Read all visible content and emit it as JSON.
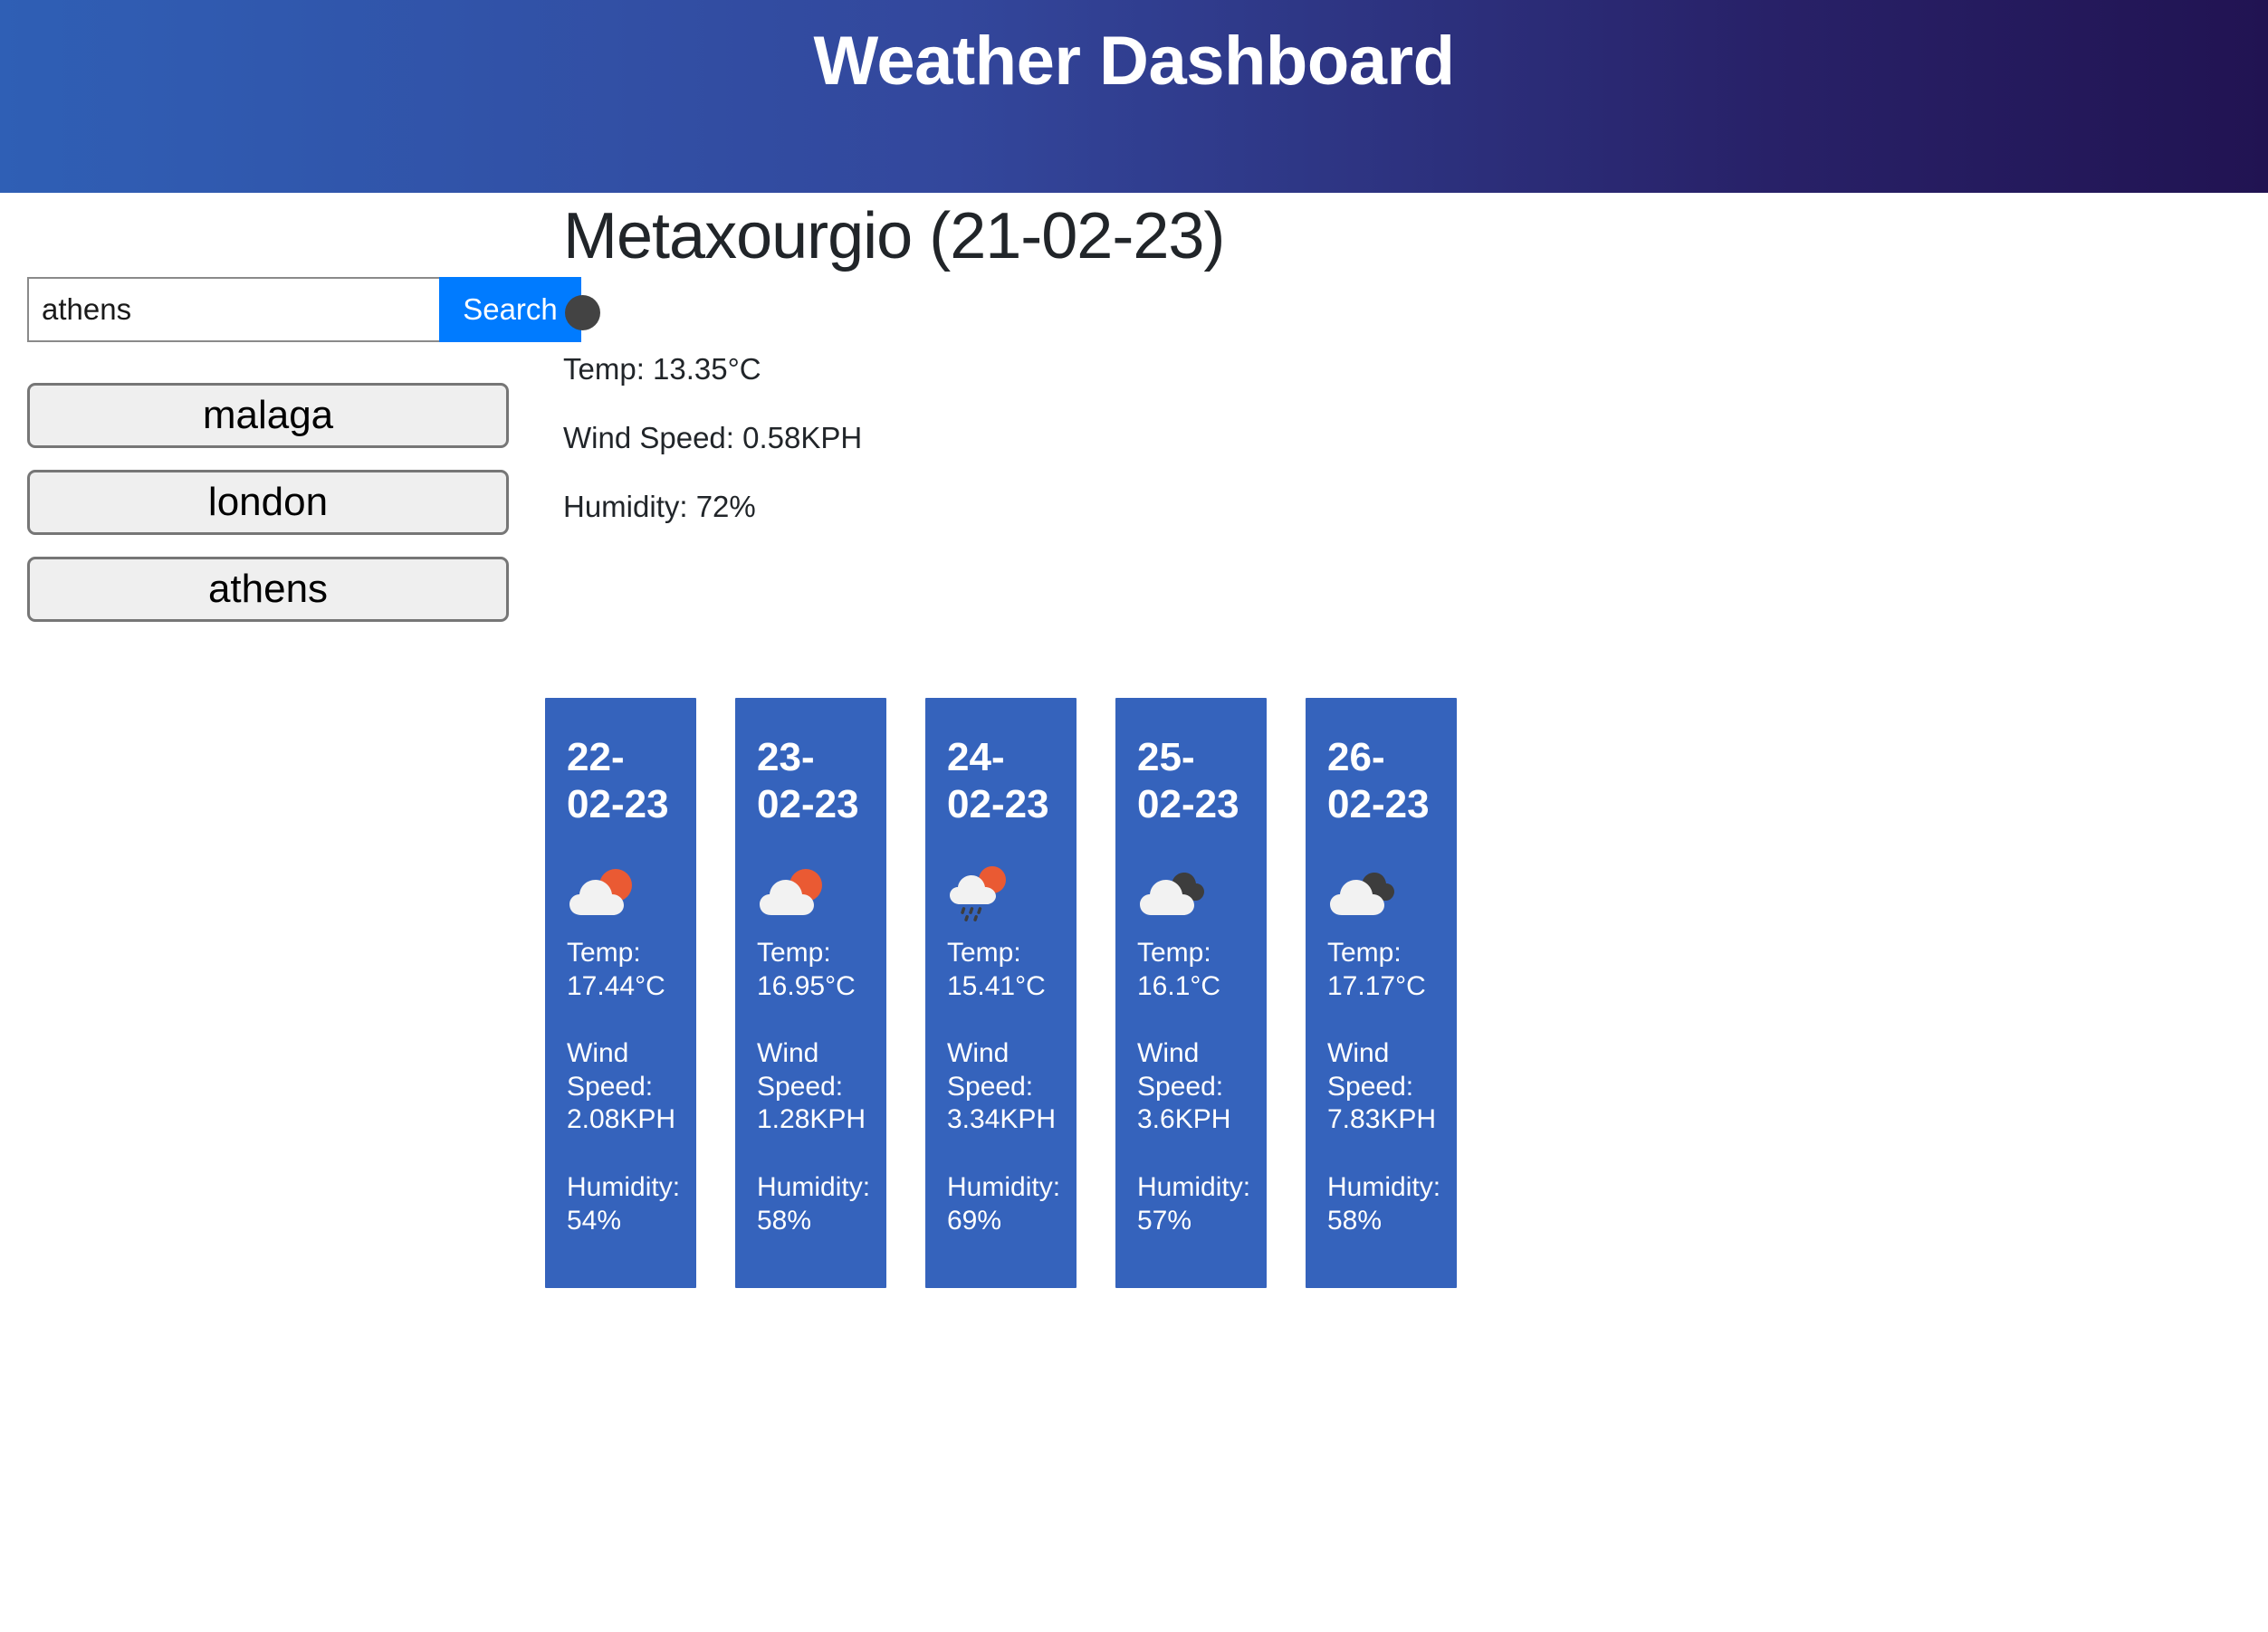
{
  "header": {
    "title": "Weather Dashboard",
    "gradient_start": "#2f5fb5",
    "gradient_end": "#211352"
  },
  "search": {
    "value": "athens",
    "placeholder": "",
    "button_label": "Search",
    "button_color": "#007bff"
  },
  "recent_cities": [
    {
      "label": "malaga"
    },
    {
      "label": "london"
    },
    {
      "label": "athens"
    }
  ],
  "current": {
    "title": "Metaxourgio (21-02-23)",
    "city": "Metaxourgio",
    "date": "21-02-23",
    "icon": "broken-image-placeholder-icon",
    "icon_color": "#434343",
    "temp_line": "Temp: 13.35°C",
    "wind_line": "Wind Speed: 0.58KPH",
    "humidity_line": "Humidity: 72%",
    "temp": 13.35,
    "wind_speed": 0.58,
    "humidity": 72
  },
  "forecast": {
    "card_color": "#3563bc",
    "cards": [
      {
        "date": "22-02-23",
        "icon": "few-clouds-icon",
        "temp_line": "Temp: 17.44°C",
        "wind_line": "Wind Speed: 2.08KPH",
        "humidity_line": "Humidity: 54%",
        "temp": 17.44,
        "wind_speed": 2.08,
        "humidity": 54
      },
      {
        "date": "23-02-23",
        "icon": "few-clouds-icon",
        "temp_line": "Temp: 16.95°C",
        "wind_line": "Wind Speed: 1.28KPH",
        "humidity_line": "Humidity: 58%",
        "temp": 16.95,
        "wind_speed": 1.28,
        "humidity": 58
      },
      {
        "date": "24-02-23",
        "icon": "shower-rain-icon",
        "temp_line": "Temp: 15.41°C",
        "wind_line": "Wind Speed: 3.34KPH",
        "humidity_line": "Humidity: 69%",
        "temp": 15.41,
        "wind_speed": 3.34,
        "humidity": 69
      },
      {
        "date": "25-02-23",
        "icon": "broken-clouds-icon",
        "temp_line": "Temp: 16.1°C",
        "wind_line": "Wind Speed: 3.6KPH",
        "humidity_line": "Humidity: 57%",
        "temp": 16.1,
        "wind_speed": 3.6,
        "humidity": 57
      },
      {
        "date": "26-02-23",
        "icon": "broken-clouds-icon",
        "temp_line": "Temp: 17.17°C",
        "wind_line": "Wind Speed: 7.83KPH",
        "humidity_line": "Humidity: 58%",
        "temp": 17.17,
        "wind_speed": 7.83,
        "humidity": 58
      }
    ]
  }
}
